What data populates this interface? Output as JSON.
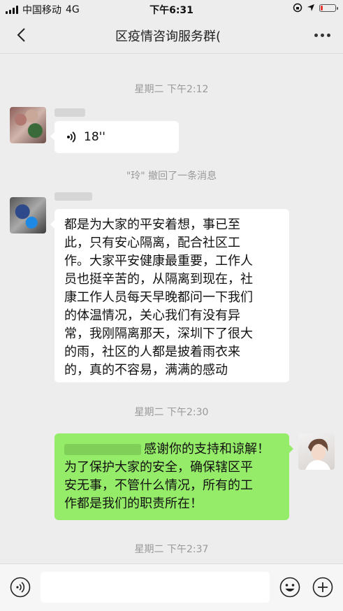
{
  "status_bar": {
    "carrier": "中国移动",
    "network": "4G",
    "time": "下午6:31",
    "battery_level": 0.15,
    "colors": {
      "battery_low": "#e53935"
    }
  },
  "nav": {
    "title": "区疫情咨询服务群(",
    "back_icon": "chevron-left-icon",
    "more_icon": "more-dots-icon"
  },
  "messages": [
    {
      "type": "timestamp",
      "text": "星期二 下午2:12"
    },
    {
      "type": "voice",
      "side": "left",
      "duration": "18''"
    },
    {
      "type": "recall",
      "text": "\"玲\" 撤回了一条消息"
    },
    {
      "type": "text",
      "side": "left",
      "lines": [
        "都是为大家的平安着想，事已至",
        "此，只有安心隔离，配合社区工",
        "作。大家平安健康最重要，工作人",
        "员也挺辛苦的，从隔离到现在，社",
        "康工作人员每天早晚都问一下我们",
        "的体温情况，关心我们有没有异",
        "常，我刚隔离那天，深圳下了很大",
        "的雨，社区的人都是披着雨衣来",
        "的，真的不容易，满满的感动"
      ]
    },
    {
      "type": "timestamp",
      "text": "星期二 下午2:30"
    },
    {
      "type": "text",
      "side": "right",
      "lines": [
        "感谢你的支持和谅解！",
        "为了保护大家的安全，确保辖区平",
        "安无事，不管什么情况，所有的工",
        "作都是我们的职责所在！"
      ]
    },
    {
      "type": "timestamp",
      "text": "星期二 下午2:37"
    }
  ],
  "input_bar": {
    "voice_icon": "voice-mode-icon",
    "emoji_icon": "emoji-icon",
    "plus_icon": "plus-icon"
  },
  "colors": {
    "background": "#ededed",
    "bubble_self": "#95ec69",
    "bubble_other": "#ffffff",
    "timestamp_text": "#999999"
  }
}
